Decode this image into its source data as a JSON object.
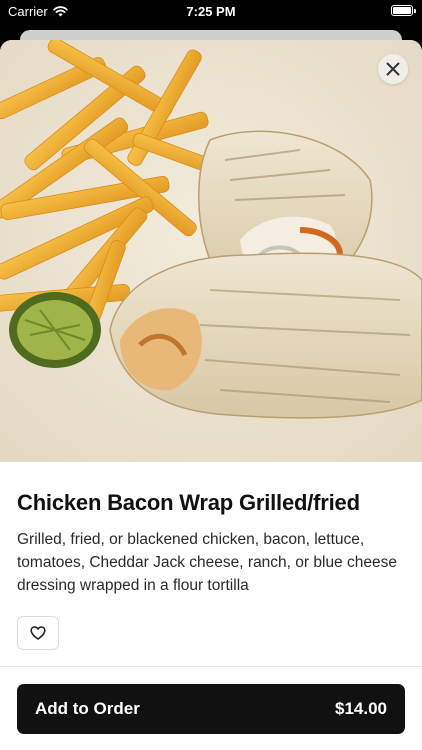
{
  "status_bar": {
    "carrier": "Carrier",
    "time": "7:25 PM",
    "wifi_icon": "wifi-icon",
    "battery_icon": "battery-icon"
  },
  "modal": {
    "close_icon": "close-icon"
  },
  "item": {
    "title": "Chicken Bacon Wrap Grilled/fried",
    "description": "Grilled, fried, or blackened chicken, bacon, lettuce, tomatoes, Cheddar Jack cheese, ranch, or blue cheese dressing wrapped in a flour tortilla",
    "favorite_icon": "heart-icon"
  },
  "order_button": {
    "label": "Add to Order",
    "price": "$14.00"
  },
  "colors": {
    "button_bg": "#111111",
    "sheet_bg": "#ffffff",
    "plate": "#ece4d3"
  }
}
